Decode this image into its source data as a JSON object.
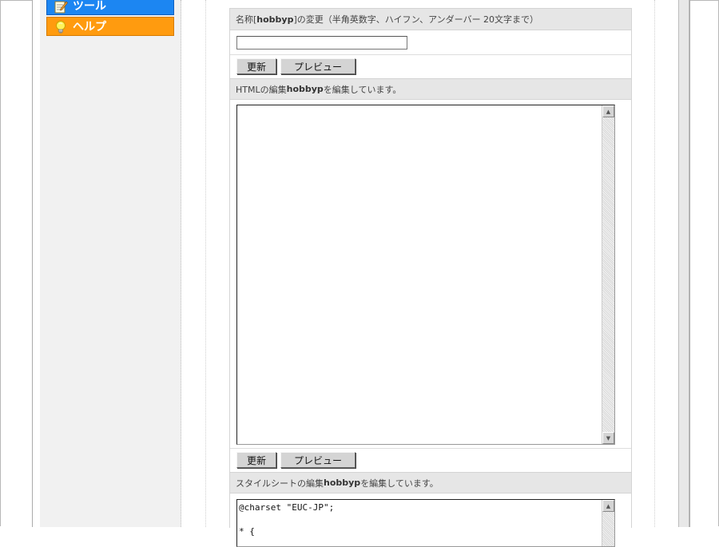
{
  "sidebar": {
    "tools_label": "ツール",
    "help_label": "ヘルプ",
    "tools_color": "#1c86f2",
    "help_color": "#ff9b0f"
  },
  "rename": {
    "header_prefix": "名称[",
    "header_name": "hobbyp",
    "header_suffix": "]の変更（半角英数字、ハイフン、アンダーバー 20文字まで）",
    "input_value": "",
    "update_label": "更新",
    "preview_label": "プレビュー"
  },
  "html_edit": {
    "header_prefix": "HTMLの編集 ",
    "header_name": "hobbyp",
    "header_suffix": "を編集しています。",
    "content": "",
    "update_label": "更新",
    "preview_label": "プレビュー"
  },
  "css_edit": {
    "header_prefix": "スタイルシートの編集 ",
    "header_name": "hobbyp",
    "header_suffix": "を編集しています。",
    "content": "@charset \"EUC-JP\";\n\n* {"
  }
}
